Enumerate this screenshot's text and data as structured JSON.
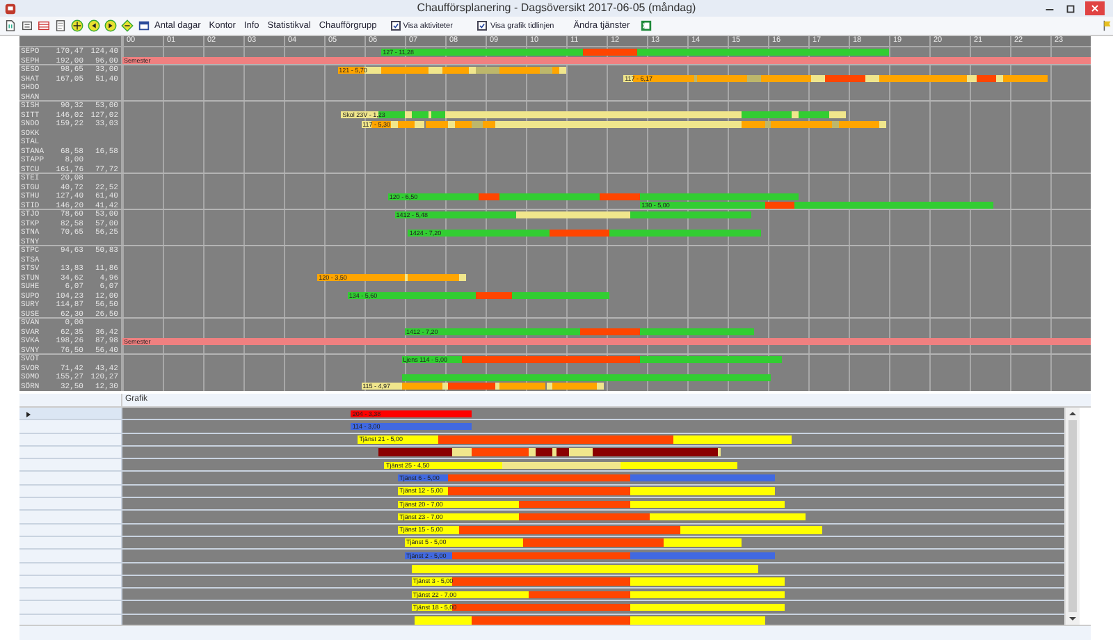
{
  "window": {
    "title": "Chaufförsplanering - Dagsöversikt 2017-06-05 (måndag)"
  },
  "toolbar": {
    "items": [
      {
        "kind": "button",
        "label": "Antal dagar"
      },
      {
        "kind": "button",
        "label": "Kontor"
      },
      {
        "kind": "button",
        "label": "Info"
      },
      {
        "kind": "button",
        "label": "Statistikval"
      },
      {
        "kind": "button",
        "label": "Chaufförgrupp"
      },
      {
        "kind": "checkbox",
        "label": "Visa aktiviteter",
        "checked": true
      },
      {
        "kind": "checkbox",
        "label": "Visa grafik tidlinjen",
        "checked": true
      },
      {
        "kind": "button",
        "label": "Ändra tjänster"
      }
    ]
  },
  "timeline": {
    "hours": [
      "00",
      "01",
      "02",
      "03",
      "04",
      "05",
      "06",
      "07",
      "08",
      "09",
      "10",
      "11",
      "12",
      "13",
      "14",
      "15",
      "16",
      "17",
      "18",
      "19",
      "20",
      "21",
      "22",
      "23"
    ]
  },
  "drivers": {
    "rows": [
      {
        "name": "SEPO",
        "value_1": "170,47",
        "value_2": "124,40",
        "group_end": false,
        "bar": {
          "label": "127 - 11,28",
          "segments": [
            {
              "kind": "gap"
            },
            {
              "kind": "block",
              "color": "#32cd32"
            },
            {
              "kind": "block",
              "color": "#ff4500"
            },
            {
              "kind": "block",
              "color": "#32cd32"
            }
          ]
        }
      },
      {
        "name": "SEPH",
        "value_1": "192,00",
        "value_2": "96,00",
        "group_end": true,
        "bar": {
          "label": "Semester",
          "segments": [
            {
              "kind": "block",
              "color": "#f08080"
            }
          ]
        }
      },
      {
        "name": "SESO",
        "value_1": "98,65",
        "value_2": "33,00",
        "group_end": false,
        "bar": {
          "label": "121 - 5,70",
          "segments": [
            {
              "kind": "gap"
            },
            {
              "kind": "block",
              "color": "#ffa500"
            },
            {
              "kind": "block",
              "color": "#f0e68c"
            },
            {
              "kind": "block",
              "color": "#ffa500"
            },
            {
              "kind": "block",
              "color": "#f0e68c"
            },
            {
              "kind": "block",
              "color": "#ffa500"
            },
            {
              "kind": "block",
              "color": "#f0e68c"
            },
            {
              "kind": "block",
              "color": "#bdb76b"
            },
            {
              "kind": "block",
              "color": "#ffa500"
            },
            {
              "kind": "block",
              "color": "#bdb76b"
            },
            {
              "kind": "block",
              "color": "#ffa500"
            },
            {
              "kind": "block",
              "color": "#f0e68c"
            }
          ]
        }
      },
      {
        "name": "SHAT",
        "value_1": "167,05",
        "value_2": "51,40",
        "group_end": false,
        "bar": {
          "label": "117 - 6,17",
          "segments": [
            {
              "kind": "gap"
            },
            {
              "kind": "block",
              "color": "#f0e68c"
            },
            {
              "kind": "block",
              "color": "#ffa500"
            },
            {
              "kind": "block",
              "color": "#bdb76b"
            },
            {
              "kind": "block",
              "color": "#ffa500"
            },
            {
              "kind": "block",
              "color": "#bdb76b"
            },
            {
              "kind": "block",
              "color": "#ffa500"
            },
            {
              "kind": "block",
              "color": "#f0e68c"
            },
            {
              "kind": "block",
              "color": "#ff4500"
            },
            {
              "kind": "block",
              "color": "#f0e68c"
            },
            {
              "kind": "block",
              "color": "#ffa500"
            },
            {
              "kind": "block",
              "color": "#f0e68c"
            },
            {
              "kind": "block",
              "color": "#ff4500"
            },
            {
              "kind": "block",
              "color": "#f0e68c"
            },
            {
              "kind": "block",
              "color": "#ffa500"
            }
          ]
        }
      },
      {
        "name": "SHDO",
        "group_end": false
      },
      {
        "name": "SHAN",
        "group_end": true
      },
      {
        "name": "SISH",
        "value_1": "90,32",
        "value_2": "53,00",
        "group_end": false
      },
      {
        "name": "SITT",
        "value_1": "146,02",
        "value_2": "127,02",
        "group_end": false,
        "bar": {
          "label": "Skol 23V - 1,23",
          "segments": [
            {
              "kind": "gap"
            },
            {
              "kind": "block",
              "color": "#f0e68c"
            },
            {
              "kind": "block",
              "color": "#32cd32"
            },
            {
              "kind": "block",
              "color": "#f0e68c"
            },
            {
              "kind": "block",
              "color": "#32cd32"
            },
            {
              "kind": "block",
              "color": "#f0e68c"
            },
            {
              "kind": "block",
              "color": "#32cd32"
            },
            {
              "kind": "block",
              "color": "#f0e68c"
            },
            {
              "kind": "block",
              "color": "#32cd32"
            },
            {
              "kind": "block",
              "color": "#f0e68c"
            },
            {
              "kind": "block",
              "color": "#32cd32"
            },
            {
              "kind": "block",
              "color": "#f0e68c"
            }
          ]
        }
      },
      {
        "name": "SNDO",
        "value_1": "159,22",
        "value_2": "33,03",
        "group_end": false,
        "bar": {
          "label": "117 - 5,30",
          "segments": [
            {
              "kind": "gap"
            },
            {
              "kind": "block",
              "color": "#f0e68c"
            },
            {
              "kind": "block",
              "color": "#ffa500"
            },
            {
              "kind": "block",
              "color": "#f0e68c"
            },
            {
              "kind": "block",
              "color": "#ffa500"
            },
            {
              "kind": "block",
              "color": "#f0e68c"
            },
            {
              "kind": "block",
              "color": "#ffa500"
            },
            {
              "kind": "block",
              "color": "#f0e68c"
            },
            {
              "kind": "block",
              "color": "#ffa500"
            },
            {
              "kind": "block",
              "color": "#bdb76b"
            },
            {
              "kind": "block",
              "color": "#ffa500"
            },
            {
              "kind": "block",
              "color": "#f0e68c"
            },
            {
              "kind": "block",
              "color": "#ffa500"
            },
            {
              "kind": "block",
              "color": "#bdb76b"
            },
            {
              "kind": "block",
              "color": "#ffa500"
            },
            {
              "kind": "block",
              "color": "#bdb76b"
            },
            {
              "kind": "block",
              "color": "#ffa500"
            },
            {
              "kind": "block",
              "color": "#f0e68c"
            }
          ]
        }
      },
      {
        "name": "SOKK",
        "group_end": false
      },
      {
        "name": "STAL",
        "group_end": false
      },
      {
        "name": "STANA",
        "value_1": "68,58",
        "value_2": "16,58",
        "group_end": false
      },
      {
        "name": "STAPP",
        "value_1": "8,00",
        "group_end": false
      },
      {
        "name": "STCU",
        "value_1": "161,76",
        "value_2": "77,72",
        "group_end": true
      },
      {
        "name": "STEI",
        "value_1": "20,08",
        "group_end": false
      },
      {
        "name": "STGU",
        "value_1": "40,72",
        "value_2": "22,52",
        "group_end": false
      },
      {
        "name": "STHU",
        "value_1": "127,40",
        "value_2": "61,40",
        "group_end": false,
        "bar": {
          "label": "120 - 6,50",
          "segments": [
            {
              "kind": "gap"
            },
            {
              "kind": "block",
              "color": "#32cd32"
            },
            {
              "kind": "block",
              "color": "#ff4500"
            },
            {
              "kind": "block",
              "color": "#32cd32"
            },
            {
              "kind": "block",
              "color": "#ff4500"
            },
            {
              "kind": "block",
              "color": "#32cd32"
            }
          ]
        }
      },
      {
        "name": "STID",
        "value_1": "146,20",
        "value_2": "41,42",
        "group_end": true,
        "bar": {
          "label": "130 - 5,00",
          "segments": [
            {
              "kind": "gap"
            },
            {
              "kind": "block",
              "color": "#32cd32"
            },
            {
              "kind": "block",
              "color": "#ff4500"
            },
            {
              "kind": "block",
              "color": "#32cd32"
            }
          ]
        }
      },
      {
        "name": "STJO",
        "value_1": "78,60",
        "value_2": "53,00",
        "group_end": false,
        "bar": {
          "label": "1412 - 5,48",
          "segments": [
            {
              "kind": "gap"
            },
            {
              "kind": "block",
              "color": "#32cd32"
            },
            {
              "kind": "block",
              "color": "#f0e68c"
            },
            {
              "kind": "block",
              "color": "#32cd32"
            }
          ]
        }
      },
      {
        "name": "STKP",
        "value_1": "82,58",
        "value_2": "57,00",
        "group_end": false
      },
      {
        "name": "STNA",
        "value_1": "70,65",
        "value_2": "56,25",
        "group_end": false,
        "bar": {
          "label": "1424 - 7,20",
          "segments": [
            {
              "kind": "gap"
            },
            {
              "kind": "block",
              "color": "#32cd32"
            },
            {
              "kind": "block",
              "color": "#ff4500"
            },
            {
              "kind": "block",
              "color": "#32cd32"
            }
          ]
        }
      },
      {
        "name": "STNY",
        "group_end": true
      },
      {
        "name": "STPC",
        "value_1": "94,63",
        "value_2": "50,83",
        "group_end": false
      },
      {
        "name": "STSA",
        "group_end": false
      },
      {
        "name": "STSV",
        "value_1": "13,83",
        "value_2": "11,86",
        "group_end": false
      },
      {
        "name": "STUN",
        "value_1": "34,62",
        "value_2": "4,96",
        "group_end": false,
        "bar": {
          "label": "120 - 3,50",
          "segments": [
            {
              "kind": "gap"
            },
            {
              "kind": "block",
              "color": "#ffa500"
            },
            {
              "kind": "block",
              "color": "#f0e68c"
            },
            {
              "kind": "block",
              "color": "#ffa500"
            },
            {
              "kind": "block",
              "color": "#f0e68c"
            }
          ]
        }
      },
      {
        "name": "SUHE",
        "value_1": "6,07",
        "value_2": "6,07",
        "group_end": false
      },
      {
        "name": "SUPO",
        "value_1": "104,23",
        "value_2": "12,00",
        "group_end": false,
        "bar": {
          "label": "134 - 5,60",
          "segments": [
            {
              "kind": "gap"
            },
            {
              "kind": "block",
              "color": "#32cd32"
            },
            {
              "kind": "block",
              "color": "#ff4500"
            },
            {
              "kind": "block",
              "color": "#32cd32"
            }
          ]
        }
      },
      {
        "name": "SURY",
        "value_1": "114,87",
        "value_2": "56,50",
        "group_end": false
      },
      {
        "name": "SUSE",
        "value_1": "62,30",
        "value_2": "26,50",
        "group_end": true
      },
      {
        "name": "SVAN",
        "value_1": "0,00",
        "group_end": false
      },
      {
        "name": "SVAR",
        "value_1": "62,35",
        "value_2": "36,42",
        "group_end": false,
        "bar": {
          "label": "1412 - 7,20",
          "segments": [
            {
              "kind": "gap"
            },
            {
              "kind": "block",
              "color": "#32cd32"
            },
            {
              "kind": "block",
              "color": "#ff4500"
            },
            {
              "kind": "block",
              "color": "#32cd32"
            }
          ]
        }
      },
      {
        "name": "SVKA",
        "value_1": "198,26",
        "value_2": "87,98",
        "group_end": false,
        "bar": {
          "label": "Semester",
          "segments": [
            {
              "kind": "block",
              "color": "#f08080"
            }
          ]
        }
      },
      {
        "name": "SVNY",
        "value_1": "76,50",
        "value_2": "56,40",
        "group_end": true
      },
      {
        "name": "SVOT",
        "group_end": false,
        "bar": {
          "label": "Ljens 114 - 5,00",
          "segments": [
            {
              "kind": "gap"
            },
            {
              "kind": "block",
              "color": "#32cd32"
            },
            {
              "kind": "block",
              "color": "#ff4500"
            },
            {
              "kind": "block",
              "color": "#32cd32"
            }
          ]
        }
      },
      {
        "name": "SVOR",
        "value_1": "71,42",
        "value_2": "43,42",
        "group_end": false
      },
      {
        "name": "SOMO",
        "value_1": "155,27",
        "value_2": "120,27",
        "group_end": false,
        "bar": {
          "segments": [
            {
              "kind": "gap"
            },
            {
              "kind": "block",
              "color": "#32cd32"
            }
          ]
        }
      },
      {
        "name": "SÖRN",
        "value_1": "32,50",
        "value_2": "12,30",
        "group_end": false,
        "bar": {
          "label": "115 - 4,97",
          "segments": [
            {
              "kind": "gap"
            },
            {
              "kind": "block",
              "color": "#f0e68c"
            },
            {
              "kind": "block",
              "color": "#ffa500"
            },
            {
              "kind": "block",
              "color": "#f0e68c"
            },
            {
              "kind": "block",
              "color": "#ff4500"
            },
            {
              "kind": "block",
              "color": "#f0e68c"
            },
            {
              "kind": "block",
              "color": "#ffa500"
            },
            {
              "kind": "block",
              "color": "#f0e68c"
            },
            {
              "kind": "block",
              "color": "#ffa500"
            },
            {
              "kind": "block",
              "color": "#f0e68c"
            }
          ]
        }
      }
    ]
  },
  "graphic": {
    "header": "Grafik",
    "rows": [
      {
        "selected": true,
        "bar": {
          "label": "204 - 3,38",
          "segments": [
            {
              "kind": "gap"
            },
            {
              "kind": "block",
              "color": "#ff0000"
            }
          ]
        }
      },
      {
        "selected": false,
        "bar": {
          "label": "114 - 3,00",
          "segments": [
            {
              "kind": "gap"
            },
            {
              "kind": "block",
              "color": "#4169e1"
            }
          ]
        }
      },
      {
        "selected": false,
        "bar": {
          "label": "Tjänst 21 - 5,00",
          "segments": [
            {
              "kind": "gap"
            },
            {
              "kind": "block",
              "color": "#ffff00"
            },
            {
              "kind": "block",
              "color": "#ff4500"
            },
            {
              "kind": "block",
              "color": "#ffff00"
            }
          ]
        }
      },
      {
        "selected": false,
        "bar": {
          "segments": [
            {
              "kind": "gap"
            },
            {
              "kind": "block",
              "color": "#8b0000"
            },
            {
              "kind": "block",
              "color": "#f0e68c"
            },
            {
              "kind": "block",
              "color": "#ff4500"
            },
            {
              "kind": "block",
              "color": "#f0e68c"
            },
            {
              "kind": "block",
              "color": "#8b0000"
            },
            {
              "kind": "block",
              "color": "#f0e68c"
            },
            {
              "kind": "block",
              "color": "#8b0000"
            },
            {
              "kind": "block",
              "color": "#f0e68c"
            },
            {
              "kind": "block",
              "color": "#8b0000"
            },
            {
              "kind": "block",
              "color": "#f0e68c"
            }
          ]
        }
      },
      {
        "selected": false,
        "bar": {
          "label": "Tjänst 25 - 4,50",
          "segments": [
            {
              "kind": "gap"
            },
            {
              "kind": "block",
              "color": "#ffff00"
            },
            {
              "kind": "block",
              "color": "#f0e68c"
            },
            {
              "kind": "block",
              "color": "#ffff00"
            }
          ]
        }
      },
      {
        "selected": false,
        "bar": {
          "label": "Tjänst 6 - 5,00",
          "segments": [
            {
              "kind": "gap"
            },
            {
              "kind": "block",
              "color": "#4169e1"
            },
            {
              "kind": "block",
              "color": "#ff4500"
            },
            {
              "kind": "block",
              "color": "#4169e1"
            }
          ]
        }
      },
      {
        "selected": false,
        "bar": {
          "label": "Tjänst 12 - 5,00",
          "segments": [
            {
              "kind": "gap"
            },
            {
              "kind": "block",
              "color": "#ffff00"
            },
            {
              "kind": "block",
              "color": "#ff4500"
            },
            {
              "kind": "block",
              "color": "#ffff00"
            }
          ]
        }
      },
      {
        "selected": false,
        "bar": {
          "label": "Tjänst 20 - 7,00",
          "segments": [
            {
              "kind": "gap"
            },
            {
              "kind": "block",
              "color": "#ffff00"
            },
            {
              "kind": "block",
              "color": "#ff4500"
            },
            {
              "kind": "block",
              "color": "#ffff00"
            }
          ]
        }
      },
      {
        "selected": false,
        "bar": {
          "label": "Tjänst 23 - 7,00",
          "segments": [
            {
              "kind": "gap"
            },
            {
              "kind": "block",
              "color": "#ffff00"
            },
            {
              "kind": "block",
              "color": "#ff4500"
            },
            {
              "kind": "block",
              "color": "#ffff00"
            }
          ]
        }
      },
      {
        "selected": false,
        "bar": {
          "label": "Tjänst 15 - 5,00",
          "segments": [
            {
              "kind": "gap"
            },
            {
              "kind": "block",
              "color": "#ffff00"
            },
            {
              "kind": "block",
              "color": "#ff4500"
            },
            {
              "kind": "block",
              "color": "#ffff00"
            }
          ]
        }
      },
      {
        "selected": false,
        "bar": {
          "label": "Tjänst 5 - 5,00",
          "segments": [
            {
              "kind": "gap"
            },
            {
              "kind": "block",
              "color": "#ffff00"
            },
            {
              "kind": "block",
              "color": "#ff4500"
            },
            {
              "kind": "block",
              "color": "#ffff00"
            }
          ]
        }
      },
      {
        "selected": false,
        "bar": {
          "label": "Tjänst 2 - 5,00",
          "segments": [
            {
              "kind": "gap"
            },
            {
              "kind": "block",
              "color": "#4169e1"
            },
            {
              "kind": "block",
              "color": "#ff4500"
            },
            {
              "kind": "block",
              "color": "#4169e1"
            }
          ]
        }
      },
      {
        "selected": false,
        "bar": {
          "segments": [
            {
              "kind": "gap"
            },
            {
              "kind": "block",
              "color": "#ffff00"
            }
          ]
        }
      },
      {
        "selected": false,
        "bar": {
          "label": "Tjänst 3 - 5,00",
          "segments": [
            {
              "kind": "gap"
            },
            {
              "kind": "block",
              "color": "#ffff00"
            },
            {
              "kind": "block",
              "color": "#ff4500"
            },
            {
              "kind": "block",
              "color": "#ffff00"
            }
          ]
        }
      },
      {
        "selected": false,
        "bar": {
          "label": "Tjänst 22 - 7,00",
          "segments": [
            {
              "kind": "gap"
            },
            {
              "kind": "block",
              "color": "#ffff00"
            },
            {
              "kind": "block",
              "color": "#ff4500"
            },
            {
              "kind": "block",
              "color": "#ffff00"
            }
          ]
        }
      },
      {
        "selected": false,
        "bar": {
          "label": "Tjänst 18 - 5,00",
          "segments": [
            {
              "kind": "gap"
            },
            {
              "kind": "block",
              "color": "#ffff00"
            },
            {
              "kind": "block",
              "color": "#ff4500"
            },
            {
              "kind": "block",
              "color": "#ffff00"
            }
          ]
        }
      },
      {
        "selected": false,
        "bar": {
          "segments": [
            {
              "kind": "gap"
            },
            {
              "kind": "block",
              "color": "#ffff00"
            },
            {
              "kind": "block",
              "color": "#ff4500"
            },
            {
              "kind": "block",
              "color": "#ffff00"
            }
          ]
        }
      }
    ]
  }
}
